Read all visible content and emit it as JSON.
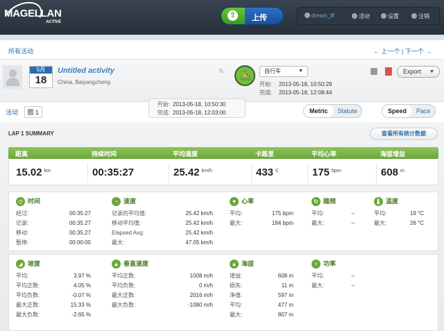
{
  "header": {
    "logo_text": "MAGELLAN",
    "logo_sub": "ACTIVE",
    "upload_label": "上传",
    "upload_icon": "upload-arrow-icon",
    "user": "dream_llf",
    "activity_label": "活动",
    "settings_label": "设置",
    "logout_label": "注销"
  },
  "breadcrumb": "所有活动",
  "pager": "← 上一个 | 下一个 →",
  "activity": {
    "month": "5月",
    "day": "18",
    "title": "Untitled activity",
    "location": "China, Baiyangcheng",
    "sport": "自行车",
    "start_label": "开始:",
    "start": "2013-05-18, 10:50:29",
    "end_label": "完成:",
    "end": "2013-05-18, 12:08:44",
    "export_label": "Export"
  },
  "tabs": {
    "activity": "活动",
    "lap": "圈 1"
  },
  "lap_times": {
    "start_label": "开始:",
    "start": "2013-05-18, 10:50:30",
    "end_label": "完成:",
    "end": "2013-05-18, 12:03:00"
  },
  "units": {
    "metric": "Metric",
    "statute": "Statute"
  },
  "speedpace": {
    "speed": "Speed",
    "pace": "Pace"
  },
  "summary": {
    "title": "LAP 1 SUMMARY",
    "all_stats": "查看所有统计数据",
    "headers": [
      "距离",
      "持续时间",
      "平均速度",
      "卡路里",
      "平均心率",
      "海拔增益"
    ],
    "values": [
      {
        "v": "15.02",
        "u": "km"
      },
      {
        "v": "00:35:27",
        "u": ""
      },
      {
        "v": "25.42",
        "u": "km/h"
      },
      {
        "v": "433",
        "u": "C"
      },
      {
        "v": "175",
        "u": "bpm"
      },
      {
        "v": "608",
        "u": "m"
      }
    ]
  },
  "sections1": [
    {
      "title": "时间",
      "icon": "clock-icon",
      "rows": [
        [
          "经过:",
          "00:35:27"
        ],
        [
          "记录:",
          "00:35:27"
        ],
        [
          "移动:",
          "00:35:27"
        ],
        [
          "暂停:",
          "00:00:00"
        ]
      ]
    },
    {
      "title": "速度",
      "icon": "speedometer-icon",
      "rows": [
        [
          "记录的平均值:",
          "25.42 km/h"
        ],
        [
          "移动平均值:",
          "25.42 km/h"
        ],
        [
          "Elapsed Avg:",
          "25.42 km/h"
        ],
        [
          "最大:",
          "47.05 km/h"
        ]
      ]
    },
    {
      "title": "心率",
      "icon": "heartbeat-icon",
      "rows": [
        [
          "平均:",
          "175 bpm"
        ],
        [
          "最大:",
          "184 bpm"
        ]
      ]
    },
    {
      "title": "踏频",
      "icon": "cadence-icon",
      "rows": [
        [
          "平均:",
          "–"
        ],
        [
          "最大:",
          "–"
        ]
      ]
    },
    {
      "title": "温度",
      "icon": "thermometer-icon",
      "rows": [
        [
          "平均:",
          "19 °C"
        ],
        [
          "最大:",
          "26 °C"
        ]
      ]
    }
  ],
  "sections2": [
    {
      "title": "坡度",
      "icon": "slope-icon",
      "rows": [
        [
          "平均:",
          "3.97 %"
        ],
        [
          "平均正数:",
          "4.05 %"
        ],
        [
          "平均负数:",
          "-0.07 %"
        ],
        [
          "最大正数:",
          "15.33 %"
        ],
        [
          "最大负数:",
          "-2.65 %"
        ]
      ]
    },
    {
      "title": "垂直速度",
      "icon": "mountain-icon",
      "rows": [
        [
          "平均正数:",
          "1008 m/h"
        ],
        [
          "平均负数:",
          "0 m/h"
        ],
        [
          "最大正数:",
          "2016 m/h"
        ],
        [
          "最大负数:",
          "-1080 m/h"
        ]
      ]
    },
    {
      "title": "海拔",
      "icon": "altitude-icon",
      "rows": [
        [
          "增益:",
          "608 m"
        ],
        [
          "损失:",
          "11 m"
        ],
        [
          "净值:",
          "597 m"
        ],
        [
          "平均:",
          "477 m"
        ],
        [
          "最大:",
          "807 m"
        ]
      ]
    },
    {
      "title": "功率",
      "icon": "power-icon",
      "rows": [
        [
          "平均:",
          "–"
        ],
        [
          "最大:",
          "–"
        ]
      ]
    }
  ]
}
